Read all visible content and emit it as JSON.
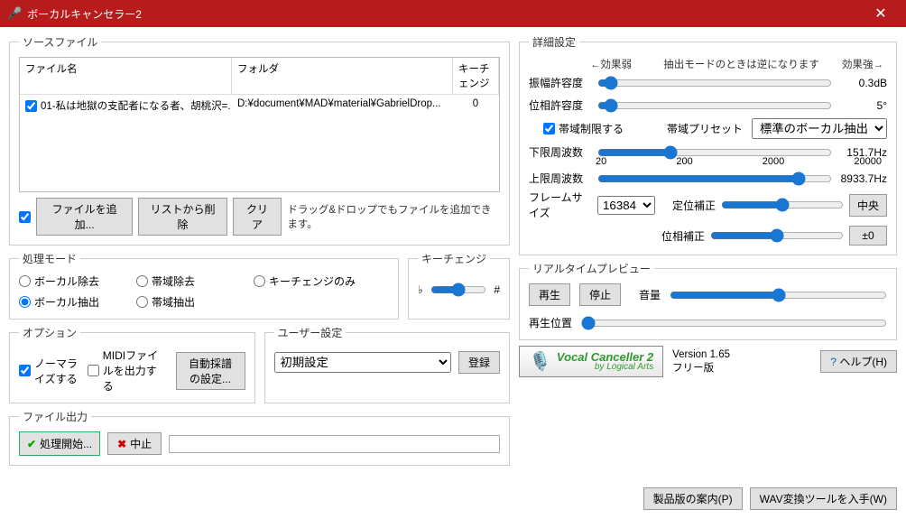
{
  "title": "ボーカルキャンセラー2",
  "sourceFile": {
    "legend": "ソースファイル",
    "cols": {
      "name": "ファイル名",
      "folder": "フォルダ",
      "key": "キーチェンジ"
    },
    "row": {
      "name": "01-私は地獄の支配者になる者、胡桃沢=...",
      "folder": "D:¥document¥MAD¥material¥GabrielDrop...",
      "key": "0"
    },
    "addFile": "ファイルを追加...",
    "removeList": "リストから削除",
    "clear": "クリア",
    "hint": "ドラッグ&ドロップでもファイルを追加できます。"
  },
  "processMode": {
    "legend": "処理モード",
    "vocalRemove": "ボーカル除去",
    "bandRemove": "帯域除去",
    "keyOnly": "キーチェンジのみ",
    "vocalExtract": "ボーカル抽出",
    "bandExtract": "帯域抽出"
  },
  "keyChange": {
    "legend": "キーチェンジ",
    "flat": "♭",
    "sharp": "#"
  },
  "options": {
    "legend": "オプション",
    "normalize": "ノーマライズする",
    "midiOut": "MIDIファイルを出力する",
    "autoScore": "自動採譜の設定..."
  },
  "userSettings": {
    "legend": "ユーザー設定",
    "preset": "初期設定",
    "register": "登録"
  },
  "fileOutput": {
    "legend": "ファイル出力",
    "start": "処理開始...",
    "stop": "中止"
  },
  "detail": {
    "legend": "詳細設定",
    "hintLeft": "←効果弱",
    "hintMid": "抽出モードのときは逆になります",
    "hintRight": "効果強→",
    "amp": "振幅許容度",
    "ampVal": "0.3dB",
    "phase": "位相許容度",
    "phaseVal": "5°",
    "bandLimit": "帯域制限する",
    "bandPresetLbl": "帯域プリセット",
    "bandPreset": "標準のボーカル抽出",
    "lowFreq": "下限周波数",
    "lowFreqVal": "151.7Hz",
    "ticks": {
      "t1": "20",
      "t2": "200",
      "t3": "2000",
      "t4": "20000"
    },
    "highFreq": "上限周波数",
    "highFreqVal": "8933.7Hz",
    "frameSize": "フレームサイズ",
    "frameVal": "16384",
    "locCorr": "定位補正",
    "center": "中央",
    "phaseCorr": "位相補正",
    "phaseCorrVal": "±0"
  },
  "realtime": {
    "legend": "リアルタイムプレビュー",
    "play": "再生",
    "stop": "停止",
    "volume": "音量",
    "pos": "再生位置"
  },
  "logo": {
    "l1": "Vocal Canceller 2",
    "l2": "by Logical Arts"
  },
  "version": {
    "ver": "Version 1.65",
    "edition": "フリー版"
  },
  "help": "ヘルプ(H)",
  "bottom": {
    "guide": "製品版の案内(P)",
    "wav": "WAV変換ツールを入手(W)"
  }
}
